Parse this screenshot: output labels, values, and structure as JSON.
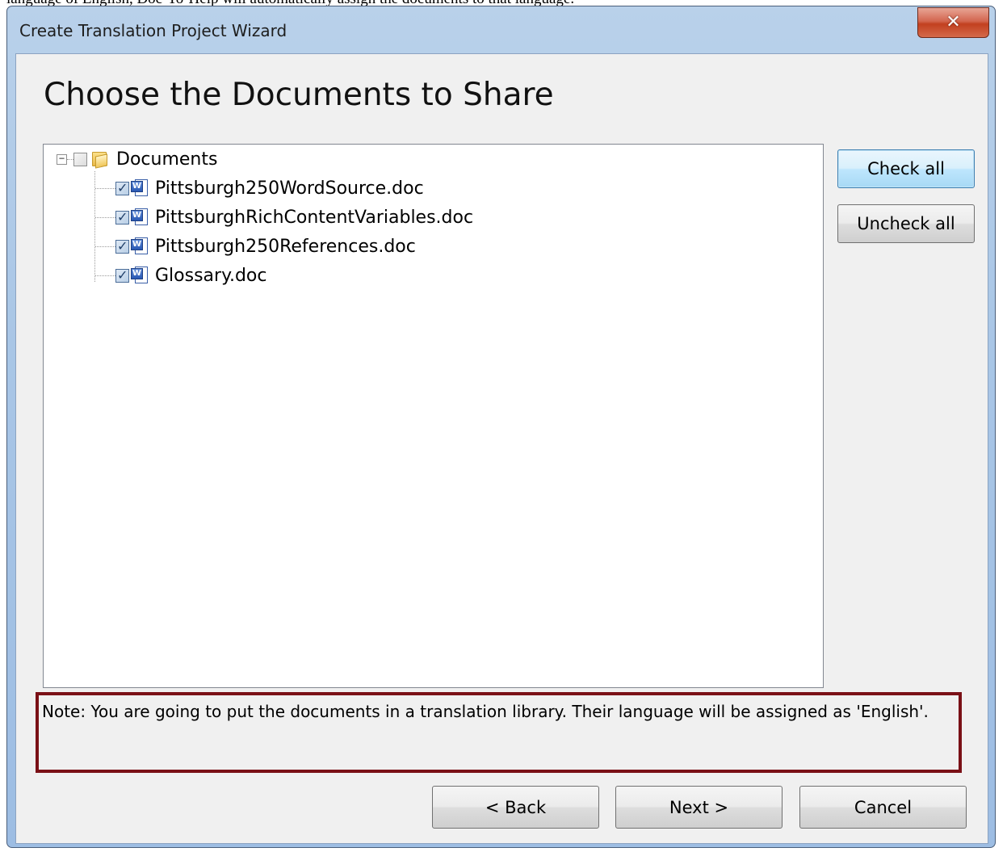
{
  "background_text": "language of English, Doc-To-Help will automatically assign the documents to that language.",
  "window": {
    "title": "Create Translation Project Wizard",
    "close_icon": "close-icon"
  },
  "page": {
    "title": "Choose the Documents to Share"
  },
  "tree": {
    "root": {
      "label": "Documents",
      "expanded": true,
      "checked": false,
      "icon": "folder-icon"
    },
    "items": [
      {
        "label": "Pittsburgh250WordSource.doc",
        "checked": true,
        "icon": "word-document-icon"
      },
      {
        "label": "PittsburghRichContentVariables.doc",
        "checked": true,
        "icon": "word-document-icon"
      },
      {
        "label": "Pittsburgh250References.doc",
        "checked": true,
        "icon": "word-document-icon"
      },
      {
        "label": "Glossary.doc",
        "checked": true,
        "icon": "word-document-icon"
      }
    ]
  },
  "side_buttons": {
    "check_all": "Check all",
    "uncheck_all": "Uncheck all"
  },
  "note": "Note: You are going to put the documents in a translation library. Their language will be assigned as 'English'.",
  "footer": {
    "back": "< Back",
    "next": "Next >",
    "cancel": "Cancel"
  },
  "colors": {
    "note_border": "#7a1016",
    "titlebar": "#a9c6e6",
    "close_button": "#c2401f"
  }
}
